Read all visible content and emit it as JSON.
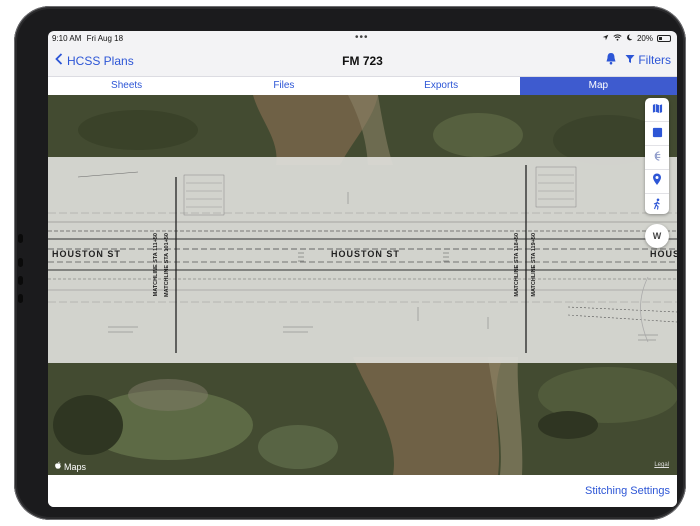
{
  "status_bar": {
    "time": "9:10 AM",
    "date": "Fri Aug 18",
    "battery": "20%",
    "icons": [
      "location-arrow-icon",
      "wifi-icon",
      "moon-icon",
      "battery-icon"
    ]
  },
  "nav": {
    "back_label": "HCSS Plans",
    "title": "FM 723",
    "filters_label": "Filters",
    "icons": [
      "chevron-left-icon",
      "bell-icon",
      "filter-icon"
    ]
  },
  "tabs": [
    {
      "label": "Sheets",
      "active": false
    },
    {
      "label": "Files",
      "active": false
    },
    {
      "label": "Exports",
      "active": false
    },
    {
      "label": "Map",
      "active": true
    }
  ],
  "map": {
    "street_label": "HOUSTON ST",
    "street_label_right": "HOUS",
    "matchlines": [
      "MATCHLINE STA 111+50",
      "MATCHLINE STA 101+50",
      "MATCHLINE STA 118+50",
      "MATCHLINE STA 119+50"
    ],
    "compass_label": "W",
    "brand_label": "Maps",
    "legal_label": "Legal",
    "controls": [
      "map-icon",
      "square-icon",
      "layers-icon",
      "location-pin-icon",
      "person-walk-icon"
    ]
  },
  "footer": {
    "stitching_settings_label": "Stitching Settings"
  },
  "colors": {
    "accent": "#2D56D6",
    "tab_active": "#3E5BCF",
    "river": "#6E6044",
    "vegetation": "#3F4A2E",
    "overlay": "#DEDED9"
  }
}
